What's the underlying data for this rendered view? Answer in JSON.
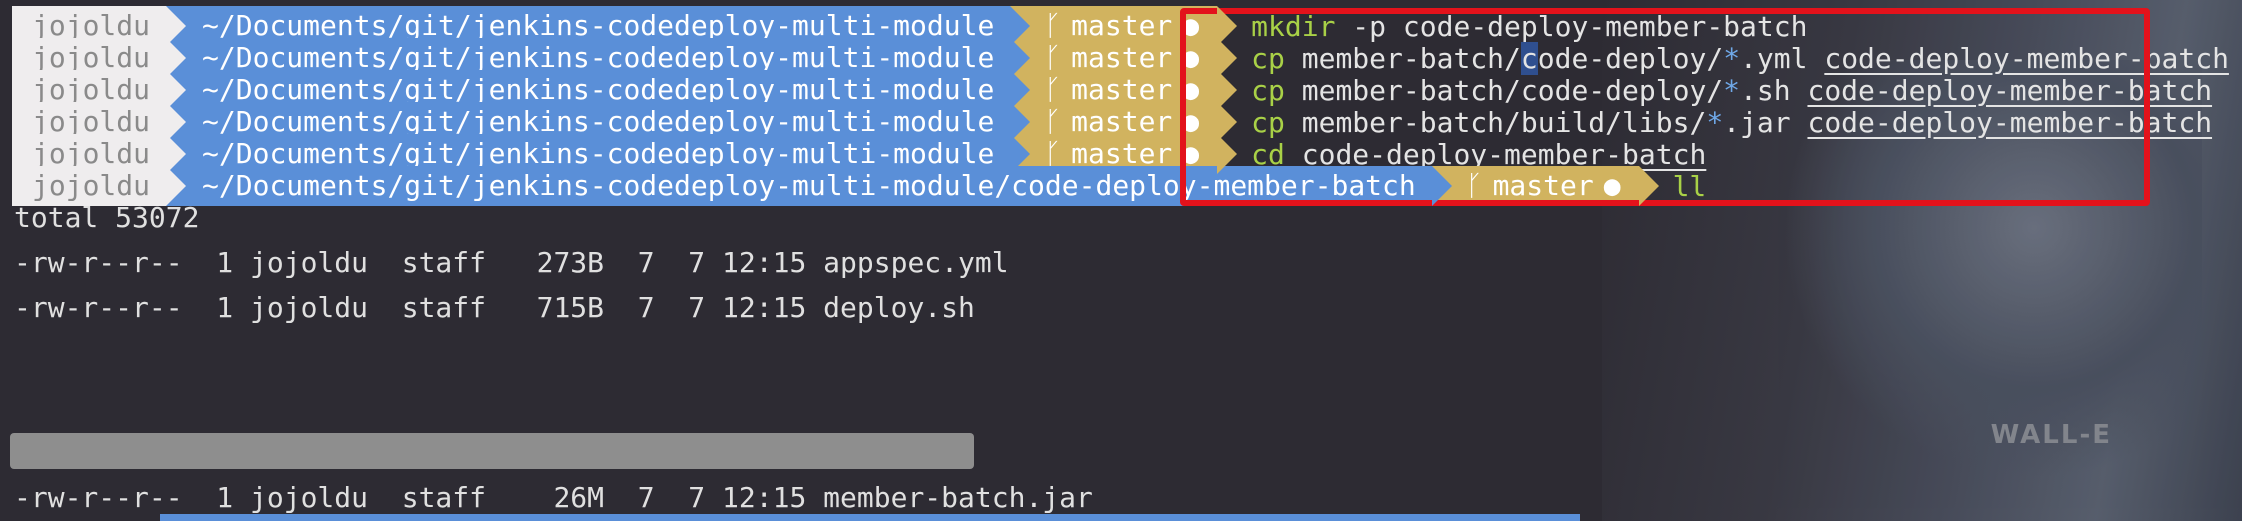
{
  "prompt": {
    "user": "jojoldu",
    "branch_icon": "git-branch-icon",
    "branch": "master",
    "dirty_marker": "●"
  },
  "rows": [
    {
      "path": "~/Documents/git/jenkins-codedeploy-multi-module",
      "cmd": "mkdir",
      "args": " -p code-deploy-member-batch"
    },
    {
      "path": "~/Documents/git/jenkins-codedeploy-multi-module",
      "cmd": "cp",
      "a1": " member-batch/",
      "cursor": "c",
      "a2": "ode-deploy/",
      "glob": "*",
      "a3": ".yml ",
      "target": "code-deploy-member-batch"
    },
    {
      "path": "~/Documents/git/jenkins-codedeploy-multi-module",
      "cmd": "cp",
      "a1": " member-batch/code-deploy/",
      "glob": "*",
      "a3": ".sh ",
      "target": "code-deploy-member-batch"
    },
    {
      "path": "~/Documents/git/jenkins-codedeploy-multi-module",
      "cmd": "cp",
      "a1": " member-batch/build/libs/",
      "glob": "*",
      "a3": ".jar ",
      "target": "code-deploy-member-batch"
    },
    {
      "path": "~/Documents/git/jenkins-codedeploy-multi-module",
      "cmd": "cd",
      "target": "code-deploy-member-batch"
    },
    {
      "path": "~/Documents/git/jenkins-codedeploy-multi-module/code-deploy-member-batch",
      "cmd": "ll"
    }
  ],
  "output": [
    "total 53072",
    "-rw-r--r--  1 jojoldu  staff   273B  7  7 12:15 appspec.yml",
    "-rw-r--r--  1 jojoldu  staff   715B  7  7 12:15 deploy.sh",
    "-rw-r--r--  1 jojoldu  staff    26M  7  7 12:15 member-batch.jar"
  ],
  "wallpaper_text": "WALL-E",
  "colors": {
    "user_segment": "#efedee",
    "path_segment": "#5a8fd8",
    "git_segment": "#d1b35f",
    "command_keyword": "#a9d147",
    "highlight_border": "#e3121b"
  }
}
